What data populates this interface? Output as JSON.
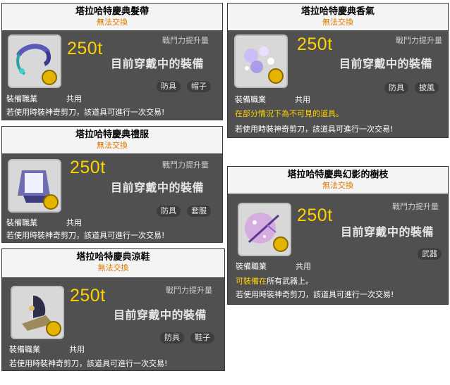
{
  "common": {
    "trade": "無法交換",
    "price": "250t",
    "stat_label": "戰鬥力提升量",
    "equipped": "目前穿戴中的裝備",
    "job_label": "裝備職業",
    "job_value": "共用",
    "scissors": "若使用時裝神奇剪刀，該道具可進行一次交易!"
  },
  "cards": [
    {
      "name": "塔拉哈特慶典髮帶",
      "tags": [
        "防具",
        "帽子"
      ]
    },
    {
      "name": "塔拉哈特慶典香氣",
      "tags": [
        "防具",
        "披風"
      ],
      "note": "在部分情況下為不可見的道具。"
    },
    {
      "name": "塔拉哈特慶典禮服",
      "tags": [
        "防具",
        "套服"
      ]
    },
    {
      "name": "塔拉哈特慶典幻影的樹枝",
      "tags": [
        "武器"
      ],
      "note_hl": "可裝備在",
      "note_rest": "所有武器上。"
    },
    {
      "name": "塔拉哈特慶典涼鞋",
      "tags": [
        "防具",
        "鞋子"
      ]
    }
  ],
  "colors": {
    "price": "#ffd200",
    "trade": "#e07a00",
    "panel": "#505050",
    "header": "#f4f4f4"
  }
}
